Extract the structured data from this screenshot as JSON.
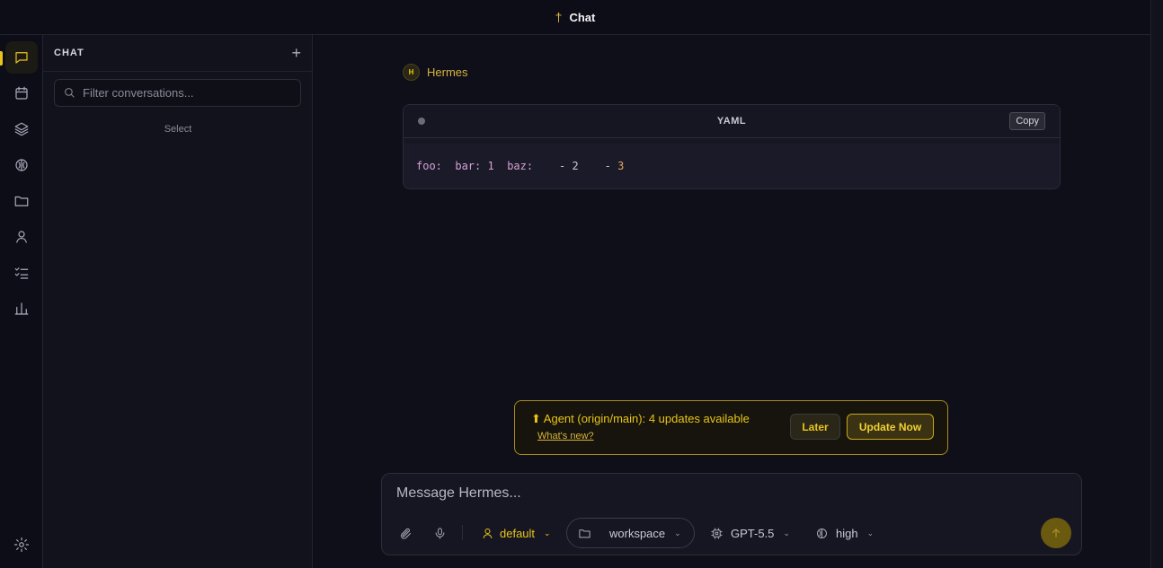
{
  "topbar": {
    "icon": "cross-icon",
    "title": "Chat"
  },
  "colors": {
    "accent": "#e8c518",
    "background": "#0f0f1a",
    "sidebar": "#12121c"
  },
  "rail": {
    "items": [
      {
        "name": "chat-icon",
        "active": true
      },
      {
        "name": "calendar-icon",
        "active": false
      },
      {
        "name": "layers-icon",
        "active": false
      },
      {
        "name": "brain-icon",
        "active": false
      },
      {
        "name": "folder-icon",
        "active": false
      },
      {
        "name": "user-icon",
        "active": false
      },
      {
        "name": "checklist-icon",
        "active": false
      },
      {
        "name": "chart-icon",
        "active": false
      }
    ],
    "settings": "gear-icon"
  },
  "sidebar": {
    "title": "CHAT",
    "add": "+",
    "filter_placeholder": "Filter conversations...",
    "empty_text": "Select"
  },
  "message": {
    "author_initial": "H",
    "author": "Hermes",
    "code": {
      "language": "YAML",
      "copy_label": "Copy",
      "tokens": {
        "foo": "foo:",
        "bar": "bar:",
        "bar_val": "1",
        "baz": "baz:",
        "dash1": "-",
        "val1": "2",
        "dash2": "-",
        "val2": "3"
      }
    }
  },
  "update": {
    "text": "⬆ Agent (origin/main): 4 updates available",
    "link": "What's new?",
    "later": "Later",
    "update_now": "Update Now"
  },
  "composer": {
    "placeholder": "Message Hermes...",
    "profile": "default",
    "workspace": "workspace",
    "model": "GPT-5.5",
    "effort": "high"
  }
}
